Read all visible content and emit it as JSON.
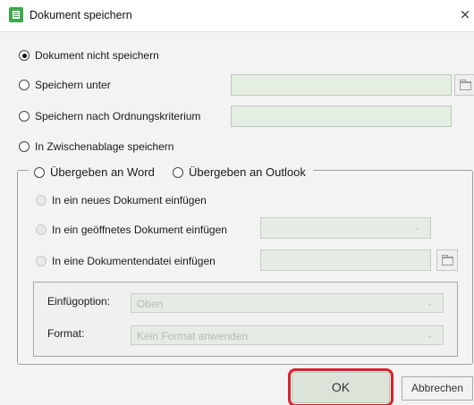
{
  "window": {
    "title": "Dokument speichern",
    "close_glyph": "×",
    "icon": "document-app-icon"
  },
  "options": {
    "no_save": "Dokument nicht speichern",
    "save_as": "Speichern unter",
    "save_by_criterion": "Speichern nach Ordnungskriterium",
    "clipboard": "In Zwischenablage speichern"
  },
  "group": {
    "word_label": "Übergeben an Word",
    "outlook_label": "Übergeben an Outlook",
    "new_document": "In ein neues Dokument einfügen",
    "open_document": "In ein geöffnetes Dokument einfügen",
    "document_file": "In eine Dokumentendatei einfügen"
  },
  "insert_options": {
    "insert_option_label": "Einfügoption:",
    "insert_option_value": "Oben",
    "format_label": "Format:",
    "format_value": "Kein Format anwenden"
  },
  "buttons": {
    "ok": "OK",
    "cancel": "Abbrechen"
  },
  "state": {
    "selected_option": "no_save"
  },
  "colors": {
    "highlight": "#d8232a",
    "accent_green": "#3ea94d",
    "field_bg": "#e5eee3"
  }
}
